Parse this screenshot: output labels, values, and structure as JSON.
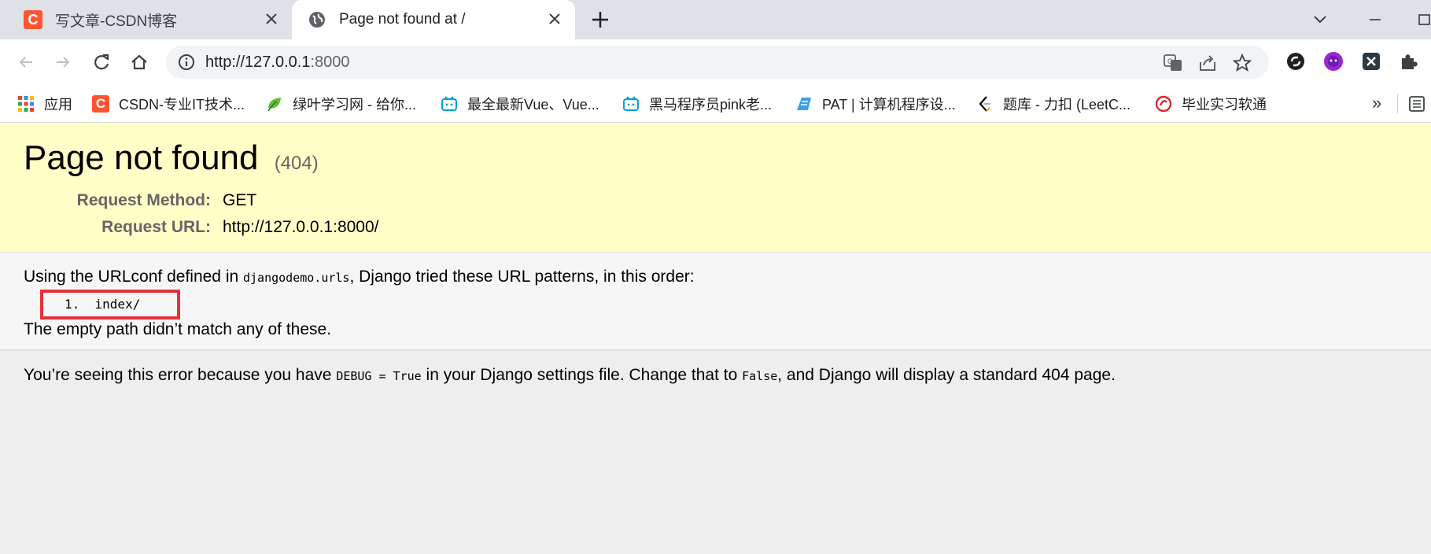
{
  "browser": {
    "tabs": [
      {
        "title": "写文章-CSDN博客",
        "favicon": "csdn-icon",
        "favicon_letter": "C"
      },
      {
        "title": "Page not found at /",
        "favicon": "globe-icon"
      }
    ],
    "address_bar": {
      "host": "http://127.0.0.1",
      "port": ":8000"
    },
    "bookmarks": [
      {
        "label": "应用",
        "icon": "apps-grid-icon"
      },
      {
        "label": "CSDN-专业IT技术...",
        "icon": "csdn-icon",
        "letter": "C"
      },
      {
        "label": "绿叶学习网 - 给你...",
        "icon": "leaf-icon"
      },
      {
        "label": "最全最新Vue、Vue...",
        "icon": "bilibili-icon"
      },
      {
        "label": "黑马程序员pink老...",
        "icon": "bilibili-icon"
      },
      {
        "label": "PAT | 计算机程序设...",
        "icon": "pat-icon"
      },
      {
        "label": "题库 - 力扣 (LeetC...",
        "icon": "leetcode-icon"
      },
      {
        "label": "毕业实习软通",
        "icon": "softcom-icon"
      }
    ],
    "bookmarks_more": "»"
  },
  "page": {
    "heading": "Page not found",
    "status_code": "(404)",
    "request_method_label": "Request Method:",
    "request_method": "GET",
    "request_url_label": "Request URL:",
    "request_url": "http://127.0.0.1:8000/",
    "urlconf_prefix": "Using the URLconf defined in ",
    "urlconf_module": "djangodemo.urls",
    "urlconf_suffix": ", Django tried these URL patterns, in this order:",
    "patterns": [
      {
        "number": "1.",
        "pattern": "index/"
      }
    ],
    "no_match": "The empty path didn’t match any of these.",
    "explain_1": "You’re seeing this error because you have ",
    "debug_code": "DEBUG = True",
    "explain_2": " in your Django settings file. Change that to ",
    "false_code": "False",
    "explain_3": ", and Django will display a standard 404 page."
  },
  "colors": {
    "summary_bg": "#ffffc8",
    "highlight_box": "#e8303a",
    "csdn_brand": "#fc5531"
  }
}
